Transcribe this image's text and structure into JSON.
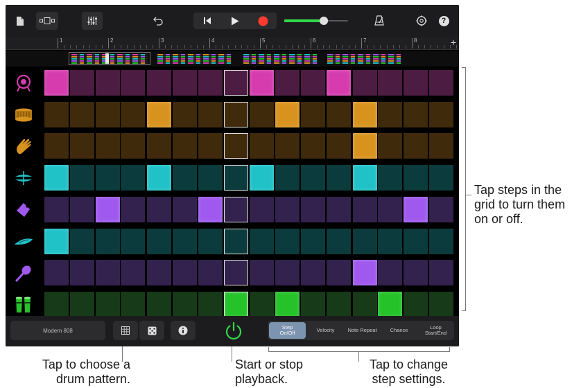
{
  "toolbar": {
    "icons": [
      "document-icon",
      "view-toggle-icon",
      "mixer-icon",
      "undo-icon",
      "go-to-start-icon",
      "play-icon",
      "record-icon",
      "master-volume-slider",
      "metronome-icon",
      "settings-icon",
      "help-icon"
    ],
    "record_color": "#ff3b30",
    "volume_color": "#32d74b",
    "volume_level": 0.62,
    "help_label": "?"
  },
  "ruler": {
    "bars": [
      "1",
      "2",
      "3",
      "4",
      "5",
      "6",
      "7",
      "8"
    ],
    "add_label": "+"
  },
  "instruments": [
    {
      "name": "kick-drum",
      "color": "#d63cae",
      "dim": "#4d1c43"
    },
    {
      "name": "snare-drum",
      "color": "#d8931f",
      "dim": "#3f2a0c"
    },
    {
      "name": "hand-clap",
      "color": "#d8931f",
      "dim": "#3f2a0c"
    },
    {
      "name": "hi-hat",
      "color": "#20c2c8",
      "dim": "#0b3b3c"
    },
    {
      "name": "cowbell",
      "color": "#9f59ee",
      "dim": "#33224d"
    },
    {
      "name": "cymbal",
      "color": "#20c2c8",
      "dim": "#0b3b3c"
    },
    {
      "name": "maraca",
      "color": "#9f59ee",
      "dim": "#33224d"
    },
    {
      "name": "conga",
      "color": "#26c22a",
      "dim": "#173a19"
    }
  ],
  "grid": {
    "steps": 16,
    "playhead_step": 7,
    "active": [
      [
        0,
        8,
        11
      ],
      [
        4,
        9,
        12
      ],
      [
        12
      ],
      [
        0,
        4,
        8,
        12
      ],
      [
        2,
        6,
        14
      ],
      [
        0
      ],
      [
        12
      ],
      [
        7,
        9,
        13
      ]
    ]
  },
  "bottom": {
    "pattern_label": "Modern 808",
    "icons": [
      "pattern-grid-icon",
      "dice-icon",
      "info-icon",
      "power-icon"
    ],
    "segments": [
      "Step On/Off",
      "Velocity",
      "Note Repeat",
      "Chance",
      "Loop Start/End"
    ],
    "active_segment": 0
  },
  "callouts": {
    "grid": "Tap steps in the grid to turn them on or off.",
    "pattern": "Tap to choose a drum pattern.",
    "playback": "Start or stop playback.",
    "settings": "Tap to change step settings."
  }
}
